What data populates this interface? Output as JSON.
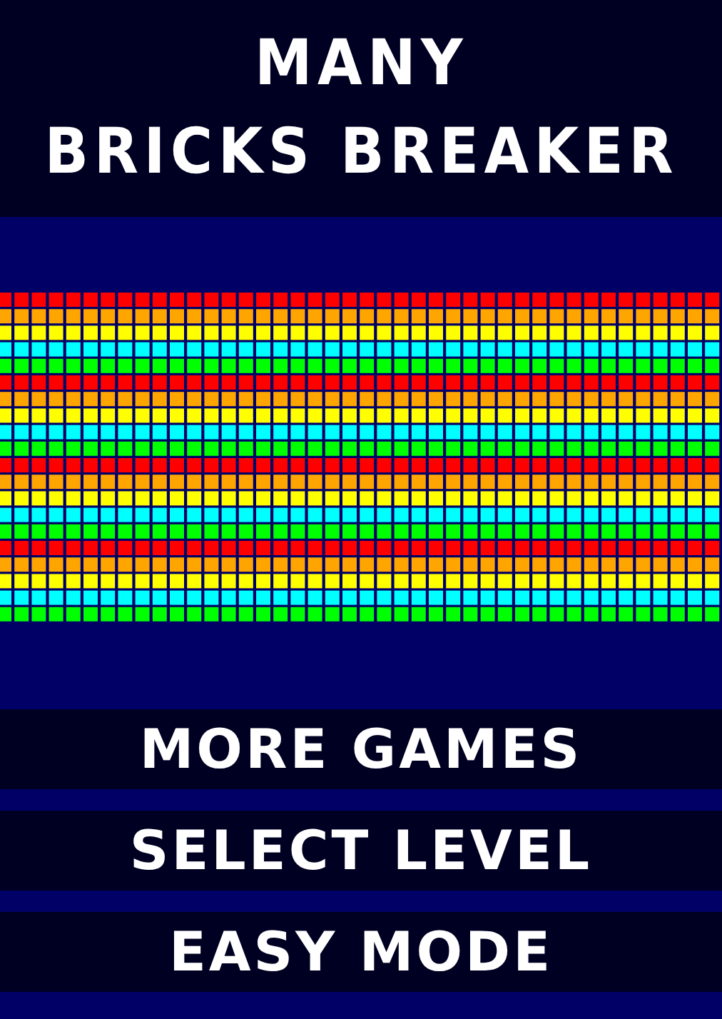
{
  "title_lines": [
    "MANY",
    "BRICKS BREAKER"
  ],
  "menu": [
    {
      "label": "MORE GAMES"
    },
    {
      "label": "SELECT LEVEL"
    },
    {
      "label": "EASY MODE"
    }
  ]
}
